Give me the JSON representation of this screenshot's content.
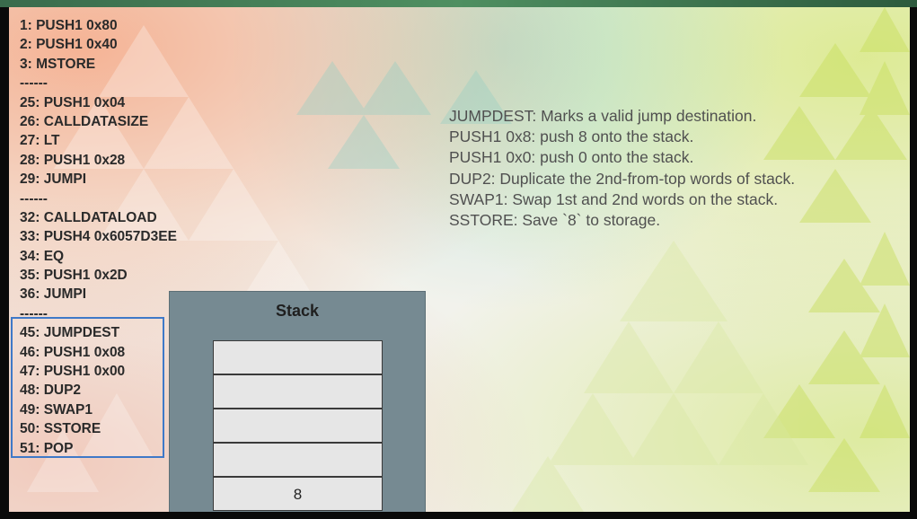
{
  "code_lines": [
    "1: PUSH1 0x80",
    "2: PUSH1 0x40",
    "3: MSTORE",
    "------",
    "25: PUSH1 0x04",
    "26: CALLDATASIZE",
    "27: LT",
    "28: PUSH1 0x28",
    "29: JUMPI",
    "------",
    "32: CALLDATALOAD",
    "33: PUSH4 0x6057D3EE",
    "34: EQ",
    "35: PUSH1 0x2D",
    "36: JUMPI",
    "------",
    "45: JUMPDEST",
    "46: PUSH1 0x08",
    "47: PUSH1 0x00",
    "48: DUP2",
    "49: SWAP1",
    "50: SSTORE",
    "51: POP"
  ],
  "stack": {
    "title": "Stack",
    "cells": [
      "",
      "",
      "",
      "",
      "8"
    ]
  },
  "descriptions": [
    "JUMPDEST: Marks a valid jump destination.",
    "PUSH1 0x8: push 8 onto the stack.",
    "PUSH1 0x0: push 0 onto the stack.",
    "DUP2: Duplicate the 2nd-from-top words of stack.",
    "SWAP1: Swap 1st and 2nd words on the stack.",
    "SSTORE: Save `8` to storage."
  ],
  "colors": {
    "highlight_border": "#3f79c8",
    "stack_panel": "#768a92",
    "frame_top": "#4f8f61"
  }
}
